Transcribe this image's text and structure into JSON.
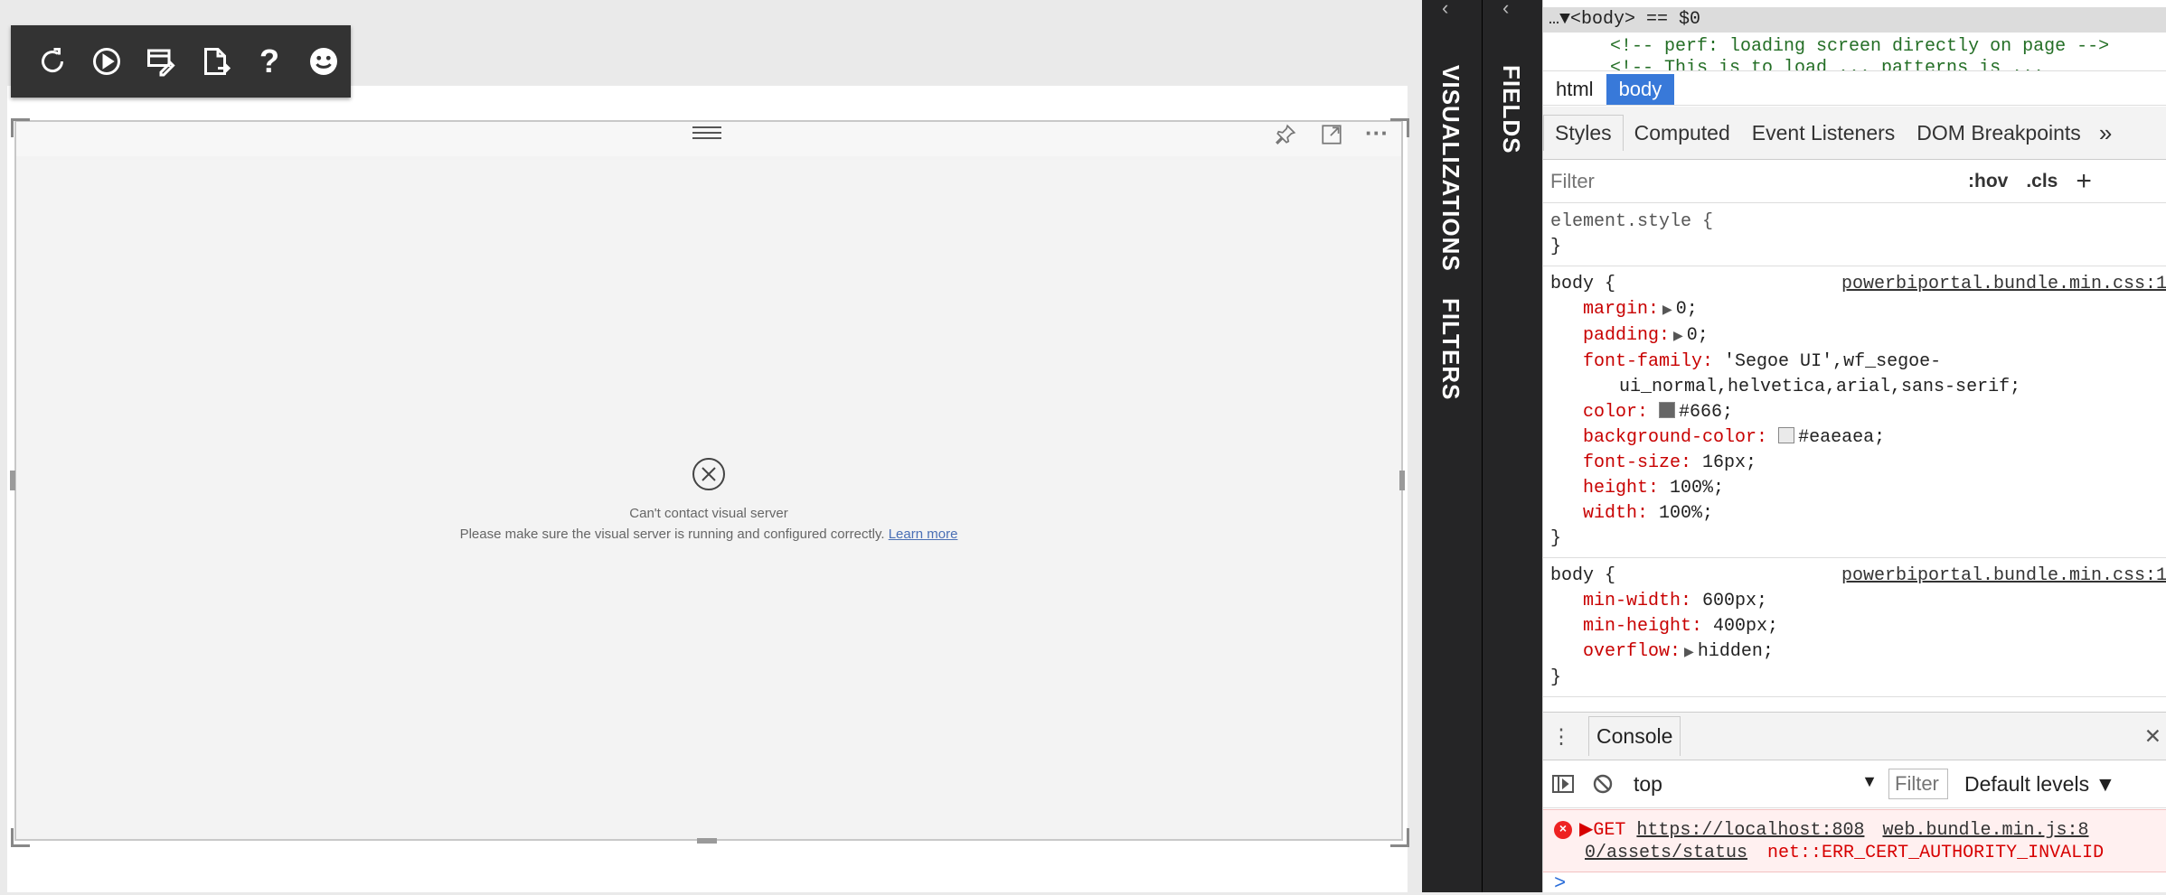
{
  "toolbar": {
    "icons": [
      "refresh-icon",
      "play-icon",
      "edit-window-icon",
      "export-icon",
      "help-icon",
      "smiley-icon"
    ],
    "help_glyph": "?"
  },
  "visual": {
    "error_title": "Can't contact visual server",
    "error_message": "Please make sure the visual server is running and configured correctly.",
    "learn_more": "Learn more",
    "more_glyph": "···"
  },
  "panes": {
    "visualizations": "VISUALIZATIONS",
    "filters": "FILTERS",
    "fields": "FIELDS"
  },
  "devtools": {
    "dom_line1": "…▼<body> == $0",
    "dom_line2": "<!-- perf: loading screen directly on page -->",
    "dom_line3": "<!-- This is to load ... patterns is ...",
    "crumbs": [
      "html",
      "body"
    ],
    "tabs": [
      "Styles",
      "Computed",
      "Event Listeners",
      "DOM Breakpoints"
    ],
    "tabs_more": "»",
    "filter_placeholder": "Filter",
    "hov": ":hov",
    "cls": ".cls",
    "add": "+",
    "element_style_open": "element.style {",
    "close_brace": "}",
    "rule1": {
      "selector": "body {",
      "source": "powerbiportal.bundle.min.css:1",
      "margin_prop": "margin:",
      "margin_val": "0;",
      "padding_prop": "padding:",
      "padding_val": "0;",
      "font_prop": "font-family:",
      "font_val1": "'Segoe UI',wf_segoe-",
      "font_val2": "ui_normal,helvetica,arial,sans-serif;",
      "color_prop": "color:",
      "color_val": "#666;",
      "bg_prop": "background-color:",
      "bg_val": "#eaeaea;",
      "fs_prop": "font-size:",
      "fs_val": "16px;",
      "h_prop": "height:",
      "h_val": "100%;",
      "w_prop": "width:",
      "w_val": "100%;"
    },
    "rule2": {
      "selector": "body {",
      "source": "powerbiportal.bundle.min.css:1",
      "minw_prop": "min-width:",
      "minw_val": "600px;",
      "minh_prop": "min-height:",
      "minh_val": "400px;",
      "of_prop": "overflow:",
      "of_val": "hidden;"
    },
    "console": {
      "tab": "Console",
      "menu": "⋮",
      "close": "✕",
      "context": "top",
      "context_arrow": "▼",
      "filter_placeholder": "Filter",
      "levels": "Default levels ▼",
      "err_method": "▶GET",
      "err_url1": "https://localhost:808",
      "err_url2": "0/assets/status",
      "err_src": "web.bundle.min.js:8",
      "err_msg": "net::ERR_CERT_AUTHORITY_INVALID",
      "prompt": ">"
    }
  },
  "colors": {
    "devtools_select": "#3879d9",
    "css_prop": "#c80000",
    "error_red": "#d70000",
    "pane_bg": "#252526",
    "toolbar_bg": "#333333",
    "swatch_color": "#666666",
    "swatch_bg": "#eaeaea"
  }
}
